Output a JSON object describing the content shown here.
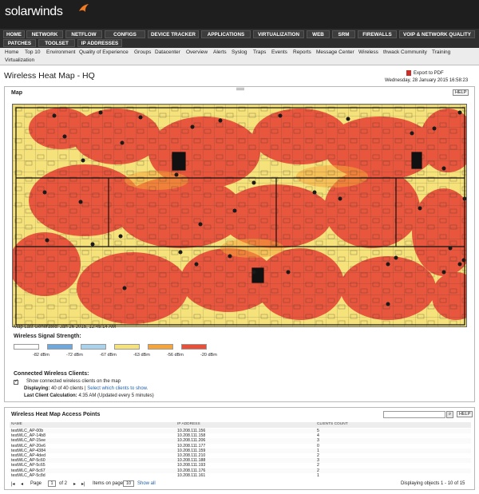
{
  "app": {
    "logo": "solarwinds"
  },
  "nav_tabs": [
    {
      "label": "HOME",
      "active": true
    },
    {
      "label": "NETWORK",
      "active": false
    },
    {
      "label": "NETFLOW",
      "active": false
    },
    {
      "label": "CONFIGS",
      "active": false
    },
    {
      "label": "DEVICE TRACKER",
      "active": false
    },
    {
      "label": "APPLICATIONS",
      "active": false
    },
    {
      "label": "VIRTUALIZATION",
      "active": false
    },
    {
      "label": "WEB",
      "active": false
    },
    {
      "label": "SRM",
      "active": false
    },
    {
      "label": "FIREWALLS",
      "active": false
    },
    {
      "label": "VOIP & NETWORK QUALITY",
      "active": false
    },
    {
      "label": "PATCHES",
      "active": false
    },
    {
      "label": "TOOLSET",
      "active": false
    },
    {
      "label": "IP ADDRESSES",
      "active": false
    }
  ],
  "sub_nav": [
    "Home",
    "Top 10",
    "Environment",
    "Quality of Experience",
    "Groups",
    "Datacenter",
    "Overview",
    "Alerts",
    "Syslog",
    "Traps",
    "Events",
    "Reports",
    "Message Center",
    "Wireless",
    "thwack Community",
    "Training",
    "Virtualization"
  ],
  "page": {
    "title": "Wireless Heat Map - HQ",
    "export_label": "Export to PDF",
    "datetime": "Wednesday, 28 January 2015 16:58:23"
  },
  "map_panel": {
    "title": "Map",
    "help_label": "HELP",
    "map_generated": "Map Last Generated: Jan 26 2015, 12:45:14 AM",
    "signal_title": "Wireless Signal Strength:",
    "signal_legend": [
      {
        "label": "-82 dBm",
        "color": "#ffffff"
      },
      {
        "label": "-72 dBm",
        "color": "#6fa8dc"
      },
      {
        "label": "-67 dBm",
        "color": "#a9d2ec"
      },
      {
        "label": "-63 dBm",
        "color": "#f6e27a"
      },
      {
        "label": "-56 dBm",
        "color": "#f4a43a"
      },
      {
        "label": "-20 dBm",
        "color": "#e8503a"
      }
    ],
    "clients_title": "Connected Wireless Clients:",
    "show_clients_label": "Show connected wireless clients on the map",
    "displaying_label": "Displaying:",
    "displaying_value": "40 of 40 clients",
    "select_clients_link": "Select which clients to show.",
    "last_calc_label": "Last Client Calculation:",
    "last_calc_value": "4:35 AM (Updated every 5 minutes)"
  },
  "ap_panel": {
    "title": "Wireless Heat Map Access Points",
    "help_label": "HELP",
    "search_icon": "search-icon",
    "columns": [
      "NAME",
      "IP ADDRESS",
      "CLIENTS COUNT"
    ],
    "rows": [
      {
        "name": "testWLC_AP-00b",
        "ip": "10.208.111.156",
        "clients": "5"
      },
      {
        "name": "testWLC_AP-14b8",
        "ip": "10.208.111.158",
        "clients": "4"
      },
      {
        "name": "testWLC_AP-15ee",
        "ip": "10.208.111.206",
        "clients": "3"
      },
      {
        "name": "testWLC_AP-20e6",
        "ip": "10.208.111.177",
        "clients": "0"
      },
      {
        "name": "testWLC_AP-4384",
        "ip": "10.208.111.159",
        "clients": "1"
      },
      {
        "name": "testWLC_AP-4ded",
        "ip": "10.208.111.210",
        "clients": "2"
      },
      {
        "name": "testWLC_AP-5c60",
        "ip": "10.208.111.188",
        "clients": "3"
      },
      {
        "name": "testWLC_AP-5c65",
        "ip": "10.208.111.193",
        "clients": "2"
      },
      {
        "name": "testWLC_AP-5c67",
        "ip": "10.208.111.176",
        "clients": "2"
      },
      {
        "name": "testWLC_AP-5c8d",
        "ip": "10.208.111.161",
        "clients": "1"
      }
    ],
    "pager": {
      "page_label": "Page",
      "page_value": "1",
      "of_label": "of 2",
      "items_label": "Items on page",
      "items_value": "10",
      "show_all": "Show all",
      "displaying": "Displaying objects 1 - 10 of 15"
    }
  },
  "colors": {
    "heat_strong": "#e8503a",
    "heat_medium": "#f4a43a",
    "heat_weak": "#f6e27a",
    "heat_low": "#a9d2ec"
  }
}
